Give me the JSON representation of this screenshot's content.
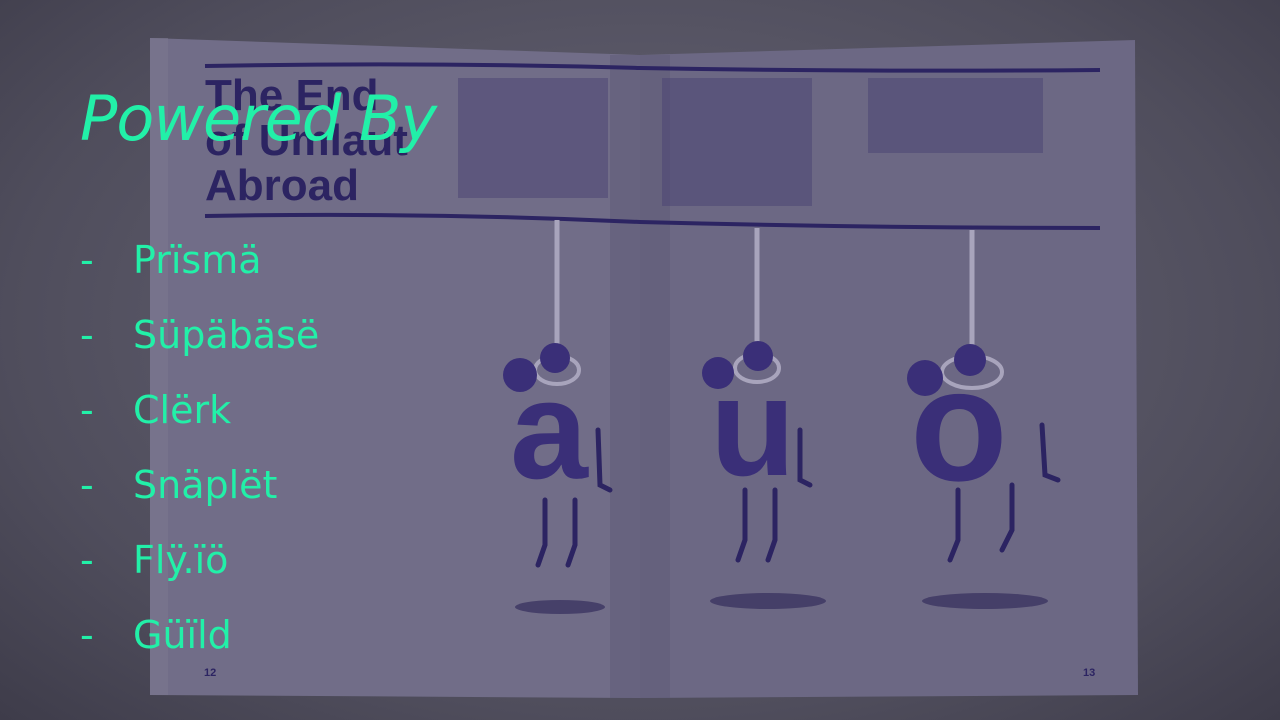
{
  "slide": {
    "title": "Powered By",
    "items": [
      {
        "bullet": "-",
        "label": "Prïsmä"
      },
      {
        "bullet": "-",
        "label": "Süpäbäsë"
      },
      {
        "bullet": "-",
        "label": "Clërk"
      },
      {
        "bullet": "-",
        "label": "Snäplët"
      },
      {
        "bullet": "-",
        "label": "Flÿ.ïö"
      },
      {
        "bullet": "-",
        "label": "Güïld"
      }
    ]
  },
  "background_magazine": {
    "headline": [
      "The End",
      "of Umlaut",
      "Abroad"
    ],
    "letters": [
      "a",
      "u",
      "o"
    ],
    "page_left": "12",
    "page_right": "13"
  },
  "colors": {
    "accent": "#22f0a8",
    "ink": "#2c2462",
    "page": "#6e6a86"
  }
}
